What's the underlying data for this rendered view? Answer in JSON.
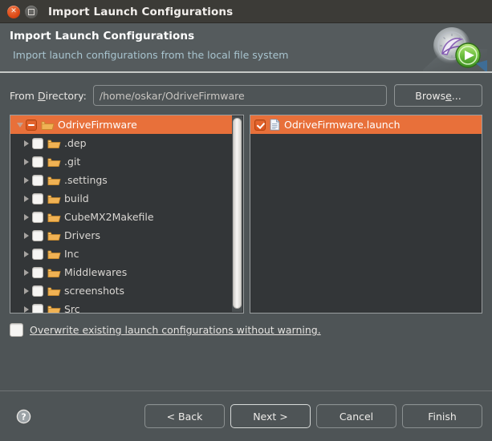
{
  "titlebar": {
    "title": "Import Launch Configurations",
    "close_icon": "close-icon",
    "maximize_icon": "maximize-icon"
  },
  "banner": {
    "title": "Import Launch Configurations",
    "subtitle": "Import launch configurations from the local file system",
    "icon": "launch-configurations-wizard-icon"
  },
  "directory": {
    "label_before": "From ",
    "label_mnemonic": "D",
    "label_after": "irectory:",
    "value": "/home/oskar/OdriveFirmware",
    "placeholder": "",
    "browse_before": "Brows",
    "browse_mnemonic": "e",
    "browse_after": "..."
  },
  "tree": {
    "items": [
      {
        "label": "OdriveFirmware",
        "icon": "folder-icon",
        "checkbox": "partial",
        "twisty": "expanded",
        "selected": true,
        "depth": 0
      },
      {
        "label": ".dep",
        "icon": "folder-icon",
        "checkbox": "unchecked",
        "twisty": "collapsed",
        "selected": false,
        "depth": 1
      },
      {
        "label": ".git",
        "icon": "folder-icon",
        "checkbox": "unchecked",
        "twisty": "collapsed",
        "selected": false,
        "depth": 1
      },
      {
        "label": ".settings",
        "icon": "folder-icon",
        "checkbox": "unchecked",
        "twisty": "collapsed",
        "selected": false,
        "depth": 1
      },
      {
        "label": "build",
        "icon": "folder-icon",
        "checkbox": "unchecked",
        "twisty": "collapsed",
        "selected": false,
        "depth": 1
      },
      {
        "label": "CubeMX2Makefile",
        "icon": "folder-icon",
        "checkbox": "unchecked",
        "twisty": "collapsed",
        "selected": false,
        "depth": 1
      },
      {
        "label": "Drivers",
        "icon": "folder-icon",
        "checkbox": "unchecked",
        "twisty": "collapsed",
        "selected": false,
        "depth": 1
      },
      {
        "label": "Inc",
        "icon": "folder-icon",
        "checkbox": "unchecked",
        "twisty": "collapsed",
        "selected": false,
        "depth": 1
      },
      {
        "label": "Middlewares",
        "icon": "folder-icon",
        "checkbox": "unchecked",
        "twisty": "collapsed",
        "selected": false,
        "depth": 1
      },
      {
        "label": "screenshots",
        "icon": "folder-icon",
        "checkbox": "unchecked",
        "twisty": "collapsed",
        "selected": false,
        "depth": 1
      },
      {
        "label": "Src",
        "icon": "folder-icon",
        "checkbox": "unchecked",
        "twisty": "collapsed",
        "selected": false,
        "depth": 1
      }
    ]
  },
  "file_list": {
    "items": [
      {
        "label": "OdriveFirmware.launch",
        "icon": "file-icon",
        "checkbox": "checked",
        "selected": true
      }
    ]
  },
  "overwrite": {
    "checked": false,
    "label_mnemonic": "O",
    "label_after": "verwrite existing launch configurations without warning."
  },
  "footer": {
    "help_icon": "help-icon",
    "buttons": [
      {
        "label": "< Back",
        "name": "back-button",
        "default": false
      },
      {
        "label": "Next >",
        "name": "next-button",
        "default": true
      },
      {
        "label": "Cancel",
        "name": "cancel-button",
        "default": false
      },
      {
        "label": "Finish",
        "name": "finish-button",
        "default": false
      }
    ]
  },
  "colors": {
    "selection": "#e8703a",
    "window_bg": "#4e5456",
    "panel_bg": "#333638",
    "titlebar_bg": "#3c3b37",
    "subtitle": "#a8c4cf"
  }
}
